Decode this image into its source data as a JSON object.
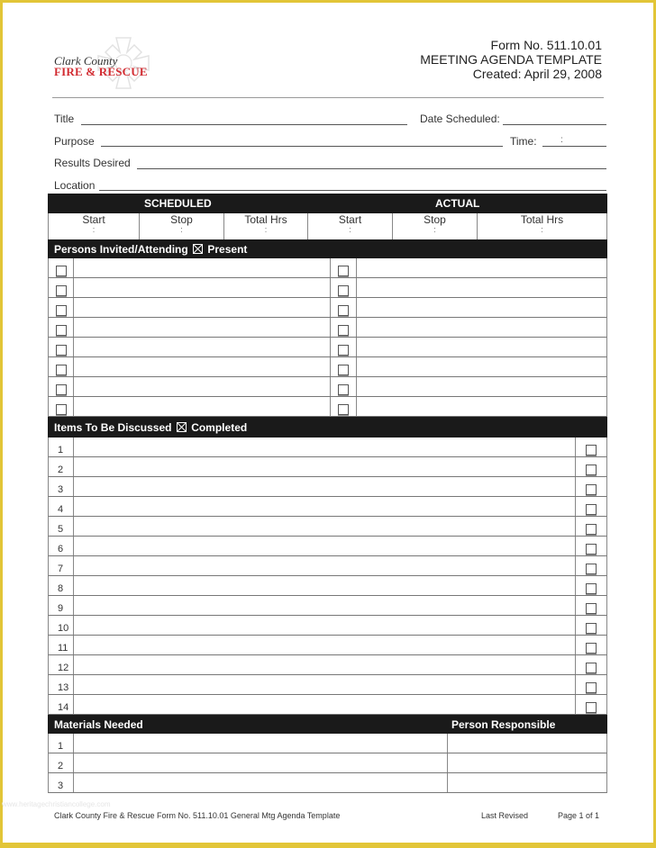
{
  "logo": {
    "line1": "Clark County",
    "line2": "FIRE & RESCUE",
    "emblem": "maltese-cross-icon",
    "brand_color": "#d22c32"
  },
  "header": {
    "form_no": "Form No. 511.10.01",
    "title": "MEETING AGENDA TEMPLATE",
    "created": "Created: April 29, 2008"
  },
  "fields": {
    "title_label": "Title",
    "date_label": "Date Scheduled:",
    "purpose_label": "Purpose",
    "time_label": "Time:",
    "time_sep": ":",
    "results_label": "Results Desired",
    "location_label": "Location"
  },
  "time_table": {
    "scheduled": "SCHEDULED",
    "actual": "ACTUAL",
    "columns": [
      "Start",
      "Stop",
      "Total Hrs",
      "Start",
      "Stop",
      "Total Hrs"
    ],
    "sep": ":"
  },
  "persons": {
    "header_pre": "Persons Invited/Attending",
    "header_icon": "checked-box-icon",
    "header_post": "Present",
    "row_count": 8
  },
  "items": {
    "header_pre": "Items To Be Discussed",
    "header_icon": "checked-box-icon",
    "header_post": "Completed",
    "numbers": [
      "1",
      "2",
      "3",
      "4",
      "5",
      "6",
      "7",
      "8",
      "9",
      "10",
      "11",
      "12",
      "13",
      "14"
    ]
  },
  "materials": {
    "header_left": "Materials Needed",
    "header_right": "Person Responsible",
    "numbers": [
      "1",
      "2",
      "3"
    ]
  },
  "footer": {
    "left": "Clark County Fire & Rescue Form No. 511.10.01 General Mtg Agenda Template",
    "mid": "Last Revised",
    "right": "Page 1 of 1",
    "watermark": "www.heritagechristiancollege.com"
  },
  "colors": {
    "border": "#e2c537",
    "header_bar": "#1a1a1a"
  }
}
